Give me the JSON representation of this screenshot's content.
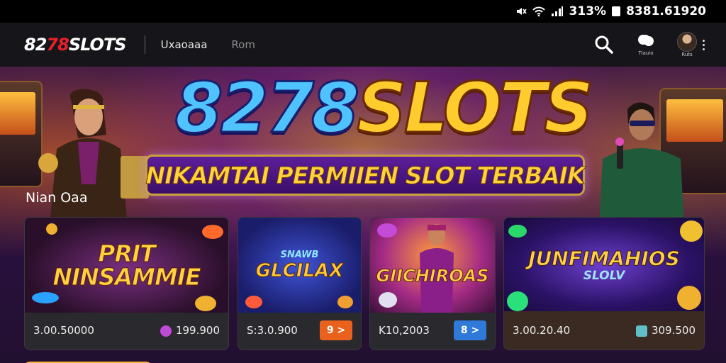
{
  "status_bar": {
    "battery": "313%",
    "time": "8381.61920"
  },
  "header": {
    "logo_prefix": "82",
    "logo_accent": "78",
    "logo_suffix": "SLOTS",
    "nav": [
      "Uxaoaaa",
      "Rom"
    ],
    "icons": [
      "search-icon",
      "chat-icon",
      "avatar",
      "more-icon"
    ],
    "chat_caption": "Tiauio",
    "avatar_caption": "Ruts"
  },
  "hero": {
    "title_blue": "8278",
    "title_gold": "SLOTS",
    "tagline": "NIKAMTAI PERMIIEN SLOT TERBAIK"
  },
  "section_title": "Nian Oaa",
  "cards": [
    {
      "title": "PRIT NINSAMMIE",
      "amount": "3.00.50000",
      "jackpot": "199.900",
      "jackpot_icon_color": "#c04ad8"
    },
    {
      "title_top": "SNAWB",
      "title": "GLCILAX",
      "amount": "S:3.0.900",
      "button": "9 >",
      "button_color": "#e8621e"
    },
    {
      "title": "GIICHIROAS",
      "amount": "K10,2003",
      "button": "8 >",
      "button_color": "#2f7ad8"
    },
    {
      "title": "JUNFIMAHIOS",
      "title_sub": "SLOLV",
      "amount": "3.00.20.40",
      "jackpot": "309.500",
      "jackpot_icon_color": "#5fc0c8"
    }
  ],
  "colors": {
    "accent_red": "#e8202b",
    "gold": "#ffcc2e",
    "blue": "#4fc3ff"
  }
}
